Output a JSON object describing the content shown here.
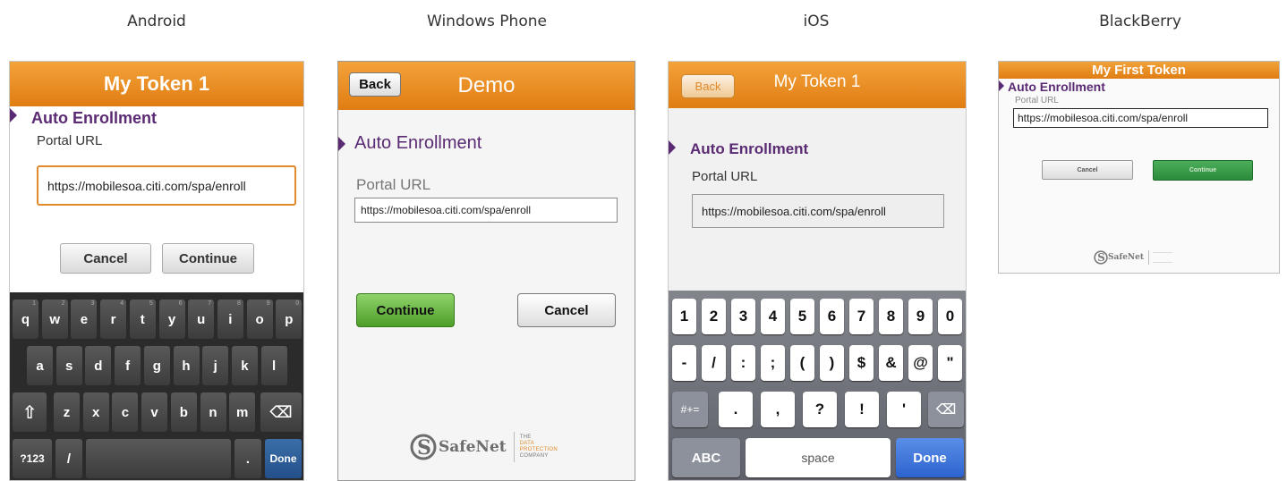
{
  "labels": {
    "android": "Android",
    "winphone": "Windows Phone",
    "ios": "iOS",
    "blackberry": "BlackBerry"
  },
  "android": {
    "title": "My Token 1",
    "section": "Auto Enrollment",
    "field_label": "Portal URL",
    "url": "https://mobilesoa.citi.com/spa/enroll",
    "cancel": "Cancel",
    "continue": "Continue",
    "keys_row1": [
      "q",
      "w",
      "e",
      "r",
      "t",
      "y",
      "u",
      "i",
      "o",
      "p"
    ],
    "keys_row1_sub": [
      "1",
      "2",
      "3",
      "4",
      "5",
      "6",
      "7",
      "8",
      "9",
      "0"
    ],
    "keys_row2": [
      "a",
      "s",
      "d",
      "f",
      "g",
      "h",
      "j",
      "k",
      "l"
    ],
    "keys_row3": [
      "z",
      "x",
      "c",
      "v",
      "b",
      "n",
      "m"
    ],
    "shift": "⇧",
    "backspace": "⌫",
    "sym": "?123",
    "slash": "/",
    "dot": ".",
    "done": "Done"
  },
  "winphone": {
    "back": "Back",
    "title": "Demo",
    "section": "Auto Enrollment",
    "field_label": "Portal URL",
    "url": "https://mobilesoa.citi.com/spa/enroll",
    "continue": "Continue",
    "cancel": "Cancel",
    "logo_text": "SafeNet",
    "tagline": [
      "THE",
      "DATA",
      "PROTECTION",
      "COMPANY"
    ]
  },
  "ios": {
    "back": "Back",
    "title": "My Token 1",
    "section": "Auto Enrollment",
    "field_label": "Portal URL",
    "url": "https://mobilesoa.citi.com/spa/enroll",
    "keys_row1": [
      "1",
      "2",
      "3",
      "4",
      "5",
      "6",
      "7",
      "8",
      "9",
      "0"
    ],
    "keys_row2": [
      "-",
      "/",
      ":",
      ";",
      "(",
      ")",
      "$",
      "&",
      "@",
      "\""
    ],
    "more_symbols": "#+=",
    "keys_row3": [
      ".",
      ",",
      "?",
      "!",
      "'"
    ],
    "backspace": "⌫",
    "abc": "ABC",
    "space": "space",
    "done": "Done"
  },
  "blackberry": {
    "title": "My First Token",
    "section": "Auto Enrollment",
    "field_label": "Portal URL",
    "url": "https://mobilesoa.citi.com/spa/enroll",
    "cancel": "Cancel",
    "continue": "Continue",
    "logo_text": "SafeNet"
  }
}
